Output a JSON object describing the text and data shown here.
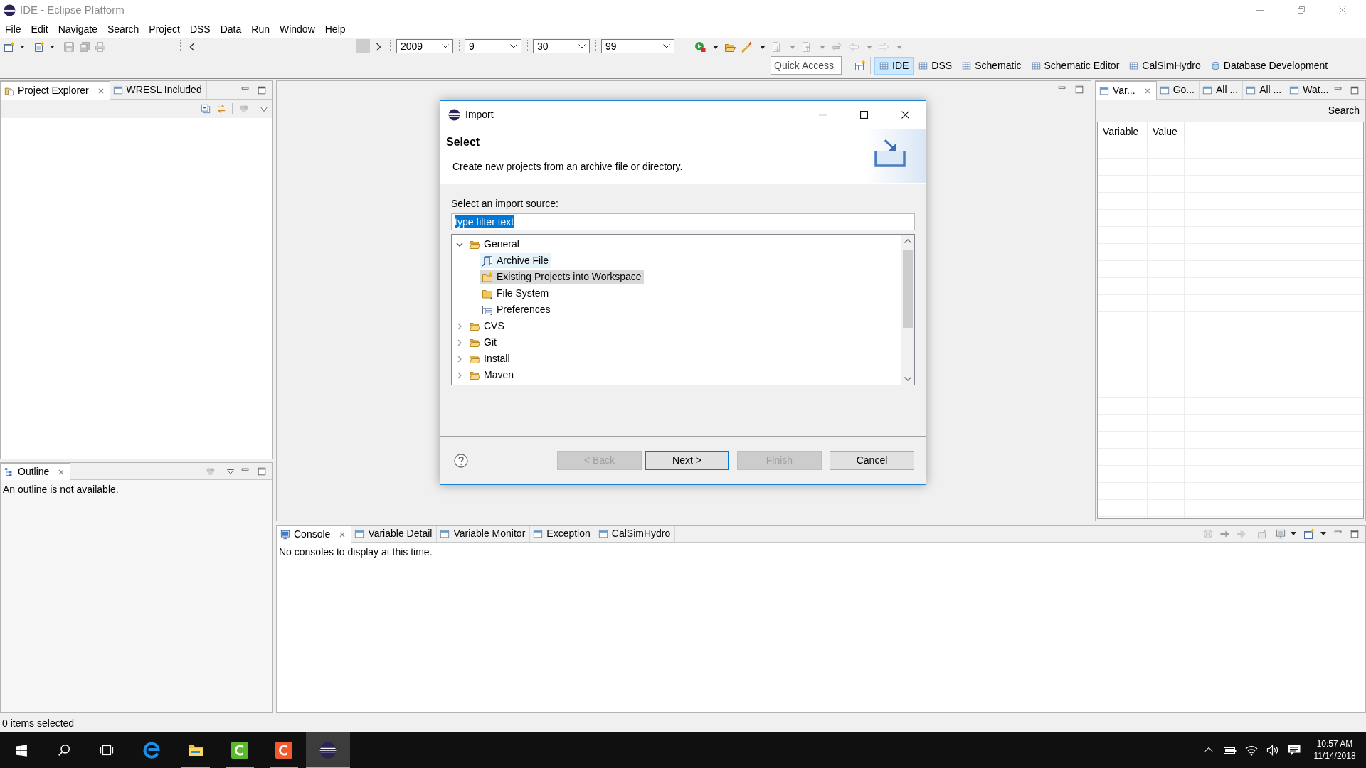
{
  "window": {
    "title": "IDE - Eclipse Platform"
  },
  "menu": [
    "File",
    "Edit",
    "Navigate",
    "Search",
    "Project",
    "DSS",
    "Data",
    "Run",
    "Window",
    "Help"
  ],
  "toolbar": {
    "left_tools": [
      {
        "kind": "new_wizard",
        "disabled": false,
        "dropdown": true
      },
      {
        "kind": "new_item",
        "disabled": false,
        "dropdown": true
      },
      {
        "kind": "save",
        "disabled": true
      },
      {
        "kind": "save_all",
        "disabled": true
      },
      {
        "kind": "print",
        "disabled": true
      }
    ],
    "date_fields": [
      {
        "value": "2009"
      },
      {
        "value": "9"
      },
      {
        "value": "30"
      },
      {
        "value": "99"
      }
    ],
    "right_tools": [
      {
        "kind": "run",
        "disabled": false,
        "dropdown": true
      },
      {
        "kind": "open_folder",
        "disabled": false
      },
      {
        "kind": "wand",
        "disabled": false,
        "dropdown": true
      },
      {
        "kind": "next_annotation",
        "disabled": true,
        "dropdown": true
      },
      {
        "kind": "prev_annotation",
        "disabled": true,
        "dropdown": true
      },
      {
        "kind": "last_edit",
        "disabled": true
      },
      {
        "kind": "back",
        "disabled": true,
        "dropdown": true
      },
      {
        "kind": "forward",
        "disabled": true,
        "dropdown": true
      }
    ],
    "quick_access": {
      "placeholder": "Quick Access"
    },
    "perspectives": [
      {
        "label": "IDE",
        "kind": "table",
        "selected": true
      },
      {
        "label": "DSS",
        "kind": "table",
        "selected": false
      },
      {
        "label": "Schematic",
        "kind": "table",
        "selected": false
      },
      {
        "label": "Schematic Editor",
        "kind": "table",
        "selected": false
      },
      {
        "label": "CalSimHydro",
        "kind": "table",
        "selected": false
      },
      {
        "label": "Database Development",
        "kind": "database",
        "selected": false
      }
    ]
  },
  "project_explorer": {
    "tabs": [
      {
        "label": "Project Explorer",
        "kind": "explorer",
        "selected": true
      },
      {
        "label": "WRESL Included",
        "kind": "view",
        "selected": false
      }
    ]
  },
  "outline": {
    "tabs": [
      {
        "label": "Outline",
        "kind": "outline",
        "selected": true
      }
    ],
    "message": "An outline is not available."
  },
  "variables_panel": {
    "tabs": [
      {
        "label": "Var...",
        "selected": true
      },
      {
        "label": "Go...",
        "selected": false
      },
      {
        "label": "All ...",
        "selected": false
      },
      {
        "label": "All ...",
        "selected": false
      },
      {
        "label": "Wat...",
        "selected": false
      }
    ],
    "search_button": "Search",
    "columns": [
      "Variable",
      "Value"
    ]
  },
  "console": {
    "tabs": [
      {
        "label": "Console",
        "kind": "console",
        "selected": true
      },
      {
        "label": "Variable Detail",
        "kind": "view",
        "selected": false
      },
      {
        "label": "Variable Monitor",
        "kind": "view",
        "selected": false
      },
      {
        "label": "Exception",
        "kind": "view",
        "selected": false
      },
      {
        "label": "CalSimHydro",
        "kind": "view",
        "selected": false
      }
    ],
    "message": "No consoles to display at this time."
  },
  "status_bar": {
    "text": "0 items selected"
  },
  "dialog": {
    "title": "Import",
    "window_buttons": [
      {
        "kind": "minimize",
        "disabled": true
      },
      {
        "kind": "maximize",
        "disabled": false
      },
      {
        "kind": "close",
        "disabled": false
      }
    ],
    "heading": "Select",
    "description": "Create new projects from an archive file or directory.",
    "source_label": "Select an import source:",
    "filter": {
      "value": "type filter text",
      "text_selected": true
    },
    "tree": [
      {
        "label": "General",
        "expanded": true,
        "selected": false,
        "hovered": false,
        "children": [
          {
            "label": "Archive File",
            "kind": "archive",
            "selected": false,
            "hovered": true
          },
          {
            "label": "Existing Projects into Workspace",
            "kind": "projects",
            "selected": true,
            "hovered": false
          },
          {
            "label": "File System",
            "kind": "folder",
            "selected": false,
            "hovered": false
          },
          {
            "label": "Preferences",
            "kind": "preferences",
            "selected": false,
            "hovered": false
          }
        ]
      },
      {
        "label": "CVS",
        "expanded": false,
        "selected": false,
        "hovered": false
      },
      {
        "label": "Git",
        "expanded": false,
        "selected": false,
        "hovered": false
      },
      {
        "label": "Install",
        "expanded": false,
        "selected": false,
        "hovered": false
      },
      {
        "label": "Maven",
        "expanded": false,
        "selected": false,
        "hovered": false
      }
    ],
    "buttons": [
      {
        "label": "< Back",
        "disabled": true,
        "default": false
      },
      {
        "label": "Next >",
        "disabled": false,
        "default": true
      },
      {
        "label": "Finish",
        "disabled": true,
        "default": false
      },
      {
        "label": "Cancel",
        "disabled": false,
        "default": false
      }
    ]
  },
  "taskbar": {
    "apps": [
      {
        "kind": "browser",
        "selected": false
      },
      {
        "kind": "files",
        "running": true,
        "selected": false
      },
      {
        "kind": "tile",
        "color": "#5cb82c",
        "running": true,
        "selected": false
      },
      {
        "kind": "tile",
        "color": "#ef5a2f",
        "running": true,
        "selected": false
      },
      {
        "kind": "ide",
        "running": true,
        "selected": true
      }
    ],
    "clock": {
      "time": "10:57 AM",
      "date": "11/14/2018"
    }
  }
}
